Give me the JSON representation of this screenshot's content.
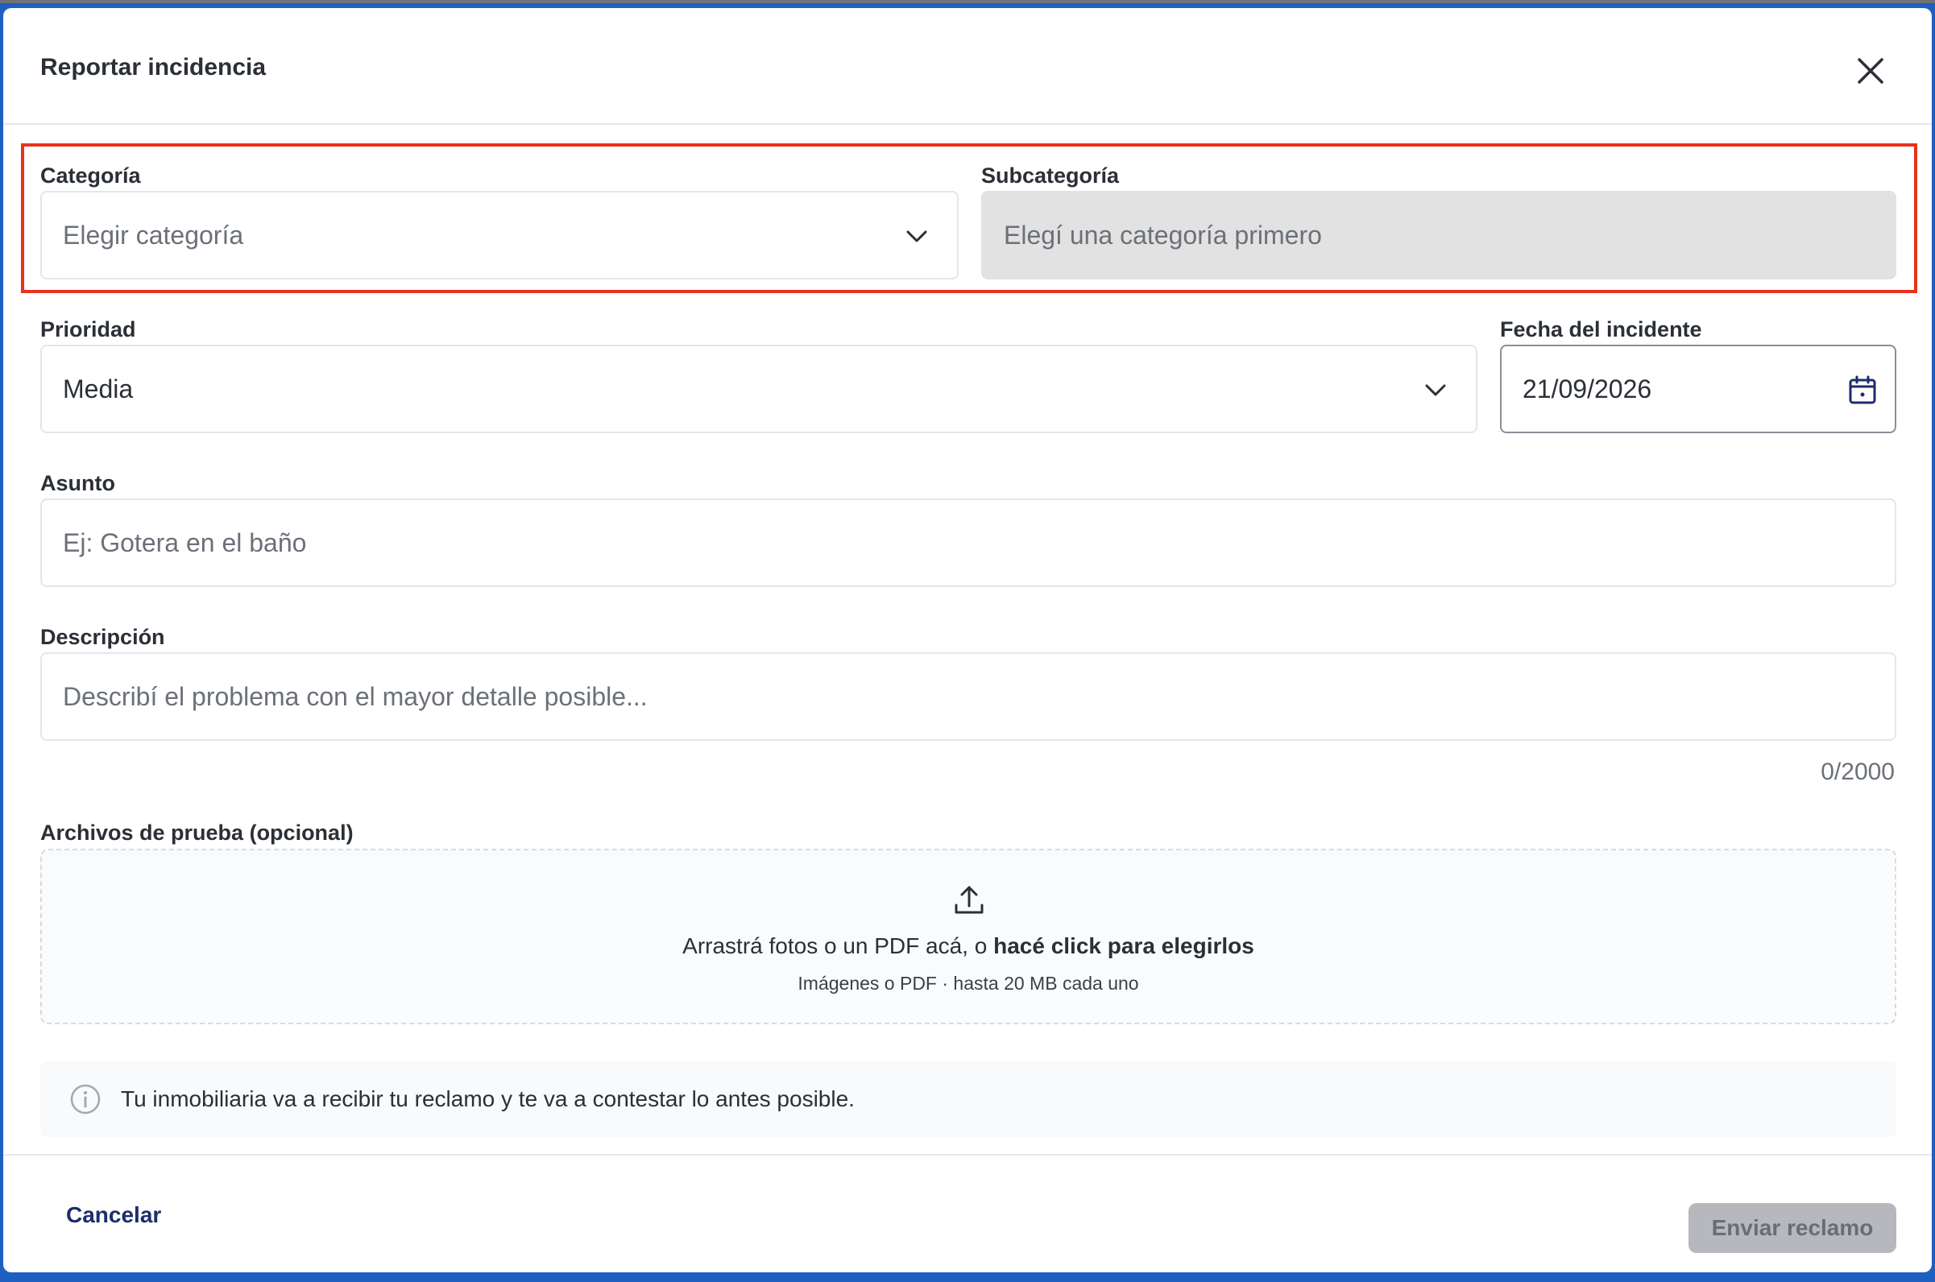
{
  "dialog": {
    "title": "Reportar incidencia"
  },
  "form": {
    "categoria": {
      "label": "Categoría",
      "placeholder": "Elegir categoría"
    },
    "subcategoria": {
      "label": "Subcategoría",
      "placeholder": "Elegí una categoría primero"
    },
    "prioridad": {
      "label": "Prioridad",
      "value": "Media"
    },
    "fecha": {
      "label": "Fecha del incidente",
      "value": "21/09/2026"
    },
    "asunto": {
      "label": "Asunto",
      "placeholder": "Ej: Gotera en el baño"
    },
    "descripcion": {
      "label": "Descripción",
      "placeholder": "Describí el problema con el mayor detalle posible...",
      "counter": "0/2000"
    },
    "archivos": {
      "label": "Archivos de prueba (opcional)",
      "drop_text": "Arrastrá fotos o un PDF acá, o ",
      "drop_link": "hacé click para elegirlos",
      "drop_hint": "Imágenes o PDF · hasta 20 MB cada uno"
    }
  },
  "info": {
    "text": "Tu inmobiliaria va a recibir tu reclamo y te va a contestar lo antes posible."
  },
  "footer": {
    "cancel_label": "Cancelar",
    "submit_label": "Enviar reclamo"
  },
  "colors": {
    "highlight": "#e8321c",
    "cancel_text": "#1c2d6b",
    "submit_disabled_bg": "#b7b8bd",
    "disabled_field_bg": "#e2e2e2"
  }
}
